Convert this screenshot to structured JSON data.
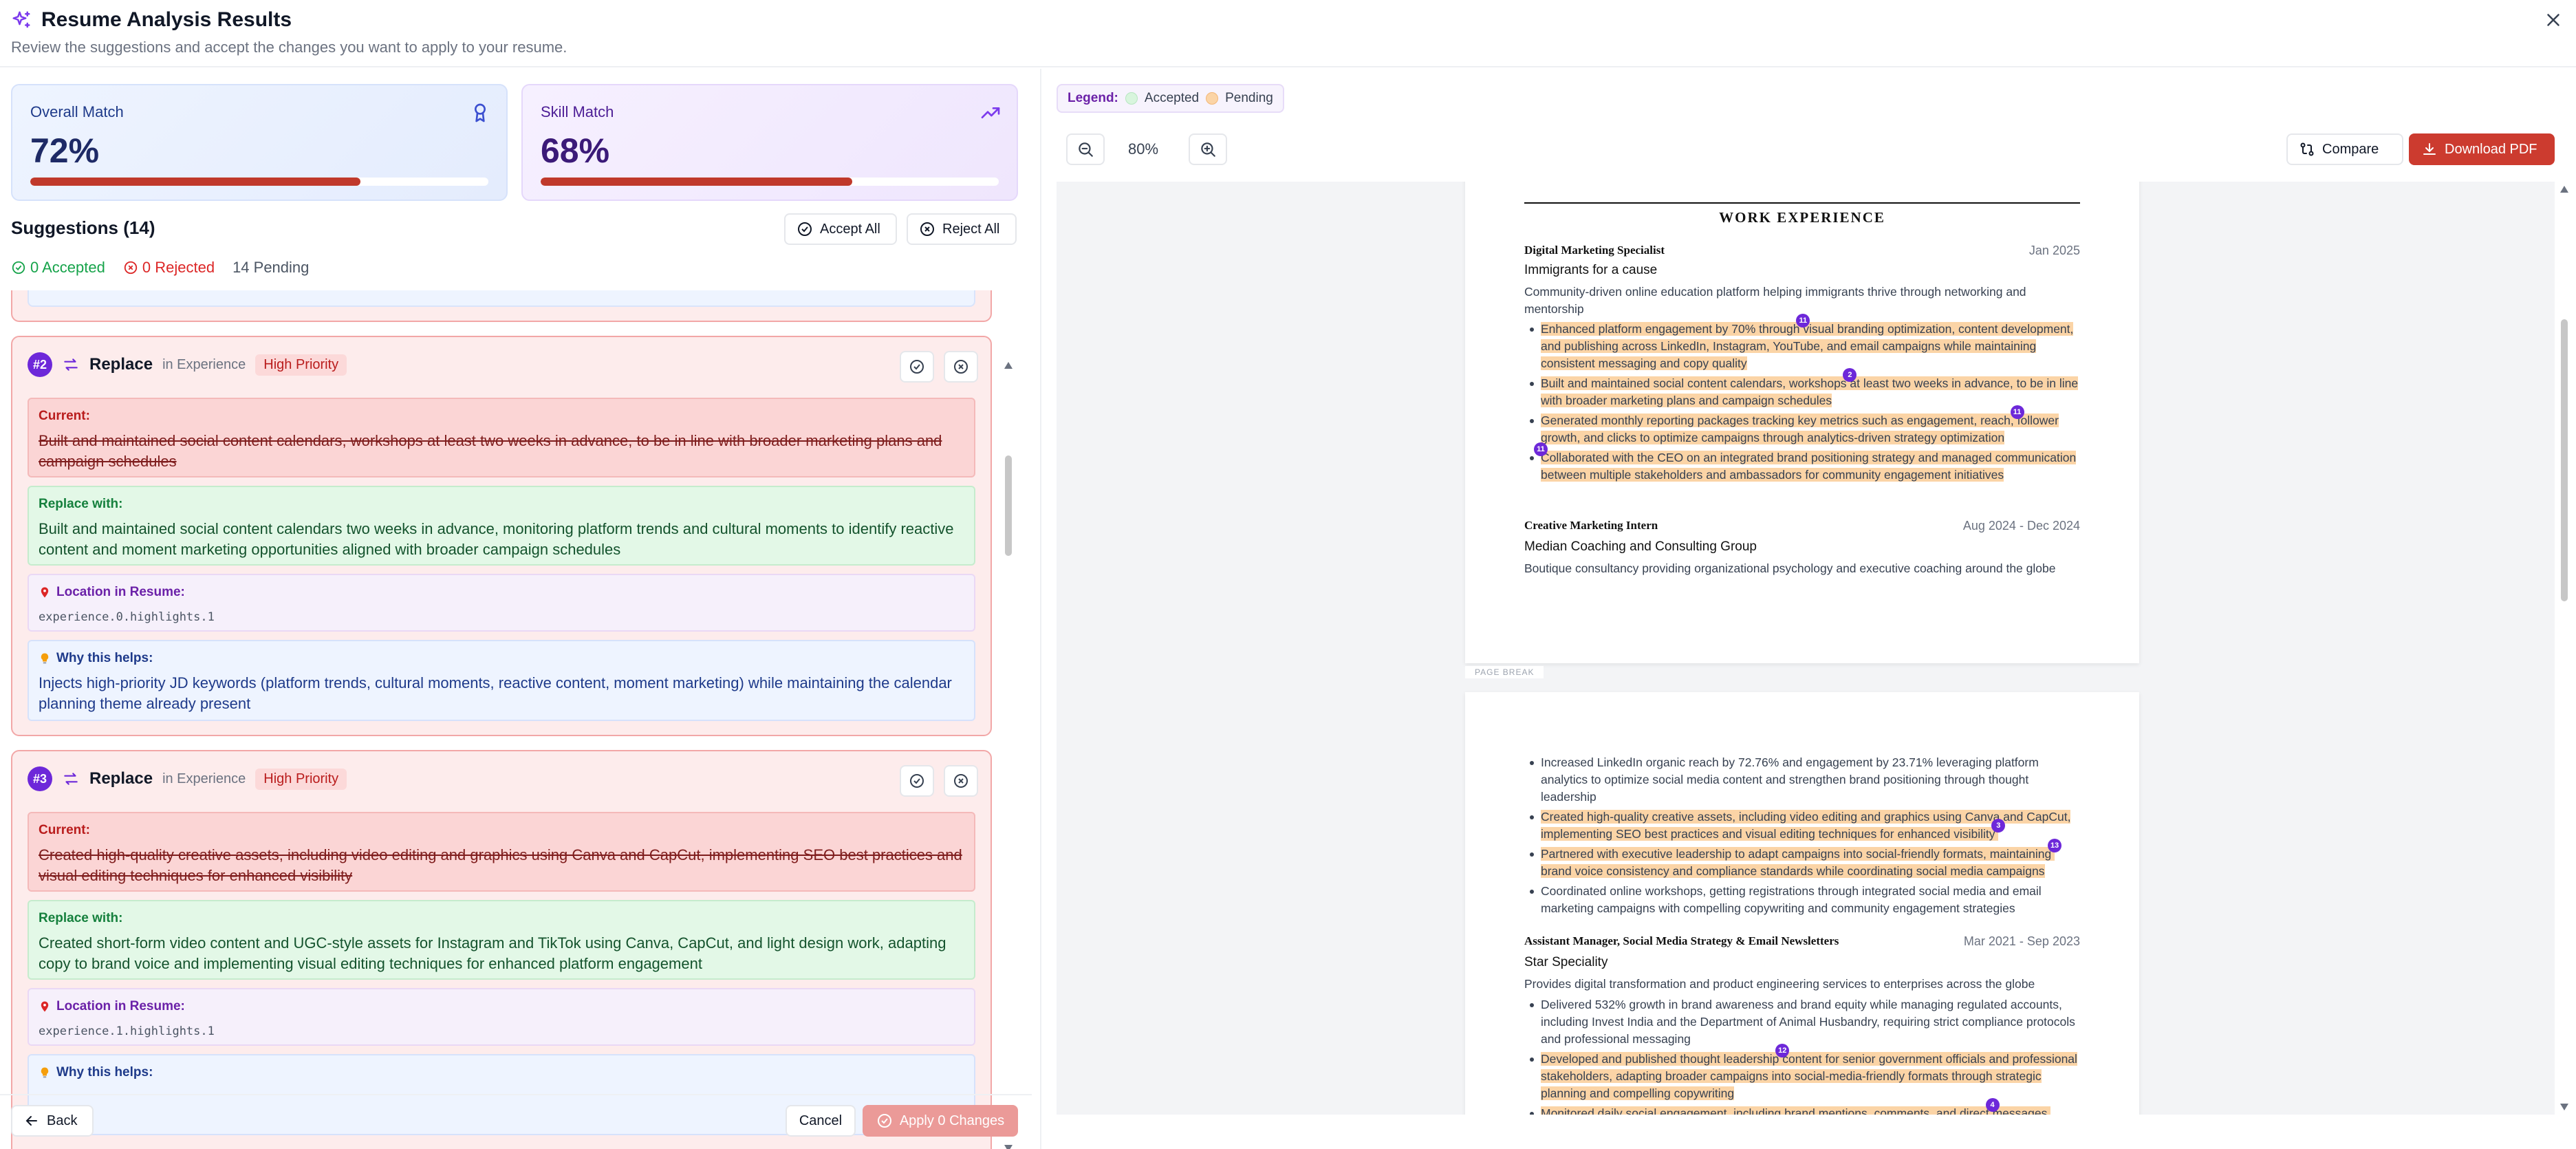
{
  "header": {
    "title": "Resume Analysis Results",
    "subtitle": "Review the suggestions and accept the changes you want to apply to your resume."
  },
  "scores": {
    "overall": {
      "label": "Overall Match",
      "value": "72%",
      "percent": 72
    },
    "skill": {
      "label": "Skill Match",
      "value": "68%",
      "percent": 68
    }
  },
  "suggestions": {
    "heading": "Suggestions (14)",
    "accept_all": "Accept All",
    "reject_all": "Reject All",
    "accepted": "0 Accepted",
    "rejected": "0 Rejected",
    "pending": "14 Pending",
    "labels": {
      "current": "Current:",
      "replace": "Replace with:",
      "location": "Location in Resume:",
      "why": "Why this helps:"
    },
    "items": [
      {
        "number": "#2",
        "type": "Replace",
        "section": "in Experience",
        "priority": "High Priority",
        "current": "Built and maintained social content calendars, workshops at least two weeks in advance, to be in line with broader marketing plans and campaign schedules",
        "replace": "Built and maintained social content calendars two weeks in advance, monitoring platform trends and cultural moments to identify reactive content and moment marketing opportunities aligned with broader campaign schedules",
        "location": "experience.0.highlights.1",
        "why": "Injects high-priority JD keywords (platform trends, cultural moments, reactive content, moment marketing) while maintaining the calendar planning theme already present"
      },
      {
        "number": "#3",
        "type": "Replace",
        "section": "in Experience",
        "priority": "High Priority",
        "current": "Created high-quality creative assets, including video editing and graphics using Canva and CapCut, implementing SEO best practices and visual editing techniques for enhanced visibility",
        "replace": "Created short-form video content and UGC-style assets for Instagram and TikTok using Canva, CapCut, and light design work, adapting copy to brand voice and implementing visual editing techniques for enhanced platform engagement",
        "location": "experience.1.highlights.1"
      }
    ]
  },
  "footer": {
    "back": "Back",
    "cancel": "Cancel",
    "apply": "Apply 0 Changes"
  },
  "preview": {
    "legend_title": "Legend:",
    "legend_accepted": "Accepted",
    "legend_pending": "Pending",
    "zoom": "80%",
    "compare": "Compare",
    "download": "Download PDF",
    "page_break": "PAGE BREAK",
    "section_title": "WORK EXPERIENCE",
    "job1": {
      "role": "Digital Marketing Specialist",
      "date": "Jan 2025",
      "company": "Immigrants for a cause",
      "desc": "Community-driven online education platform helping immigrants thrive through networking and mentorship",
      "b1a": "Enhanced platform engagement by 70% through ",
      "b1m": "11",
      "b1b": "visual branding optimization, content development, and publishing across LinkedIn, Instagram, YouTube, and email campaigns while maintaining consistent messaging and copy quality",
      "b2a": "Built and maintained social content calendars, workshops ",
      "b2m": "2",
      "b2b": "at least two weeks in advance, to be in line with broader marketing plans and campaign schedules",
      "b3a": "Generated monthly reporting packages tracking key metrics such as engagement, reach, ",
      "b3m": "11",
      "b3b": "follower growth, and clicks to optimize campaigns through analytics-driven strategy optimization",
      "b4m": "11",
      "b4": "Collaborated with the CEO on an integrated brand positioning strategy and managed communication between multiple stakeholders and ambassadors for community engagement initiatives"
    },
    "job2": {
      "role": "Creative Marketing Intern",
      "date": "Aug 2024 - Dec 2024",
      "company": "Median Coaching and Consulting Group",
      "desc": "Boutique consultancy providing organizational psychology and executive coaching around the globe",
      "p1": "Increased LinkedIn organic reach by 72.76% and engagement by 23.71% leveraging platform analytics to optimize social media content and strengthen brand positioning through thought leadership",
      "p2": "Created high-quality creative assets, including video editing and graphics using Canva and CapCut, implementing SEO best practices and visual editing techniques for enhanced visibility ",
      "p2m": "3",
      "p3a": "Partnered with executive leadership to adapt campaigns into social-friendly formats, maintaining ",
      "p3m": "13",
      "p3b": "brand voice consistency and compliance standards while coordinating social media campaigns",
      "p4": "Coordinated online workshops, getting registrations through integrated social media and email marketing campaigns with compelling copywriting and community engagement strategies"
    },
    "job3": {
      "role": "Assistant Manager, Social Media Strategy & Email Newsletters",
      "date": "Mar 2021 - Sep 2023",
      "company": "Star Speciality",
      "desc": "Provides digital transformation and product engineering services to enterprises across the globe",
      "q1": "Delivered 532% growth in brand awareness and brand equity while managing regulated accounts, including Invest India and the Department of Animal Husbandry, requiring strict compliance protocols and professional messaging",
      "q2a": "Developed and published thought leadership ",
      "q2m": "12",
      "q2b": "content for senior government officials and professional stakeholders, adapting broader campaigns into social-media-friendly formats through strategic planning and compelling copywriting",
      "q3a": "Monitored daily social engagement, including brand mentions, comments, and direct ",
      "q3m": "4",
      "q3b": "messages,"
    }
  }
}
